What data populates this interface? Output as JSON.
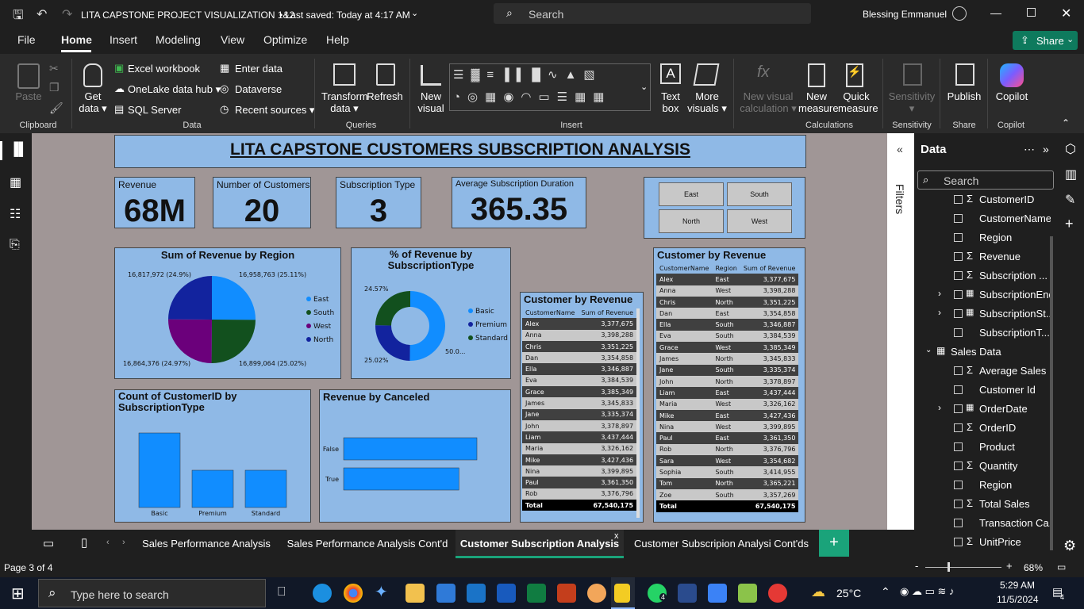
{
  "titlebar": {
    "title": "LITA CAPSTONE PROJECT VISUALIZATION 1&2",
    "saved": "• Last saved: Today at 4:17 AM",
    "search": "Search",
    "user": "Blessing Emmanuel"
  },
  "menu": [
    "File",
    "Home",
    "Insert",
    "Modeling",
    "View",
    "Optimize",
    "Help"
  ],
  "share_label": "Share",
  "ribbon": {
    "paste": "Paste",
    "get_data": "Get\ndata ▾",
    "excel": "Excel workbook",
    "onelake": "OneLake data hub ▾",
    "sql": "SQL Server",
    "enter_data": "Enter data",
    "dataverse": "Dataverse",
    "recent": "Recent sources ▾",
    "transform": "Transform\ndata ▾",
    "refresh": "Refresh",
    "new_visual": "New\nvisual",
    "text_box": "Text\nbox",
    "more_visuals": "More\nvisuals ▾",
    "new_visual_calc": "New visual\ncalculation ▾",
    "new_measure": "New\nmeasure",
    "quick_measure": "Quick\nmeasure",
    "sensitivity": "Sensitivity\n▾",
    "publish": "Publish",
    "copilot": "Copilot",
    "groups": {
      "clipboard": "Clipboard",
      "data": "Data",
      "queries": "Queries",
      "insert": "Insert",
      "calculations": "Calculations",
      "sensitivity": "Sensitivity",
      "share": "Share",
      "copilot": "Copilot"
    }
  },
  "report": {
    "title": "LITA CAPSTONE CUSTOMERS SUBSCRIPTION ANALYSIS",
    "cards": [
      {
        "label": "Revenue",
        "value": "68M"
      },
      {
        "label": "Number of Customers",
        "value": "20"
      },
      {
        "label": "Subscription Type",
        "value": "3"
      },
      {
        "label": "Average Subscription Duration",
        "value": "365.35"
      }
    ],
    "slicer": [
      "East",
      "South",
      "North",
      "West"
    ],
    "pie": {
      "title": "Sum of Revenue by Region",
      "labels": [
        "16,817,972 (24.9%)",
        "16,958,763 (25.11%)",
        "16,864,376 (24.97%)",
        "16,899,064 (25.02%)"
      ]
    },
    "donut": {
      "title": "% of Revenue by SubscriptionType",
      "labels": [
        "24.57%",
        "25.02%",
        "50.0..."
      ]
    },
    "bar_count": {
      "title": "Count of CustomerID by SubscriptionType"
    },
    "bar_canceled": {
      "title": "Revenue by Canceled"
    },
    "table1": {
      "title": "Customer by Revenue",
      "headers": [
        "CustomerName",
        "Sum of Revenue"
      ],
      "rows": [
        [
          "Alex",
          "3,377,675"
        ],
        [
          "Anna",
          "3,398,288"
        ],
        [
          "Chris",
          "3,351,225"
        ],
        [
          "Dan",
          "3,354,858"
        ],
        [
          "Ella",
          "3,346,887"
        ],
        [
          "Eva",
          "3,384,539"
        ],
        [
          "Grace",
          "3,385,349"
        ],
        [
          "James",
          "3,345,833"
        ],
        [
          "Jane",
          "3,335,374"
        ],
        [
          "John",
          "3,378,897"
        ],
        [
          "Liam",
          "3,437,444"
        ],
        [
          "Maria",
          "3,326,162"
        ],
        [
          "Mike",
          "3,427,436"
        ],
        [
          "Nina",
          "3,399,895"
        ],
        [
          "Paul",
          "3,361,350"
        ],
        [
          "Rob",
          "3,376,796"
        ]
      ],
      "total": [
        "Total",
        "67,540,175"
      ]
    },
    "table2": {
      "title": "Customer by Revenue",
      "headers": [
        "CustomerName",
        "Region",
        "Sum of Revenue"
      ],
      "rows": [
        [
          "Alex",
          "East",
          "3,377,675"
        ],
        [
          "Anna",
          "West",
          "3,398,288"
        ],
        [
          "Chris",
          "North",
          "3,351,225"
        ],
        [
          "Dan",
          "East",
          "3,354,858"
        ],
        [
          "Ella",
          "South",
          "3,346,887"
        ],
        [
          "Eva",
          "South",
          "3,384,539"
        ],
        [
          "Grace",
          "West",
          "3,385,349"
        ],
        [
          "James",
          "North",
          "3,345,833"
        ],
        [
          "Jane",
          "South",
          "3,335,374"
        ],
        [
          "John",
          "North",
          "3,378,897"
        ],
        [
          "Liam",
          "East",
          "3,437,444"
        ],
        [
          "Maria",
          "West",
          "3,326,162"
        ],
        [
          "Mike",
          "East",
          "3,427,436"
        ],
        [
          "Nina",
          "West",
          "3,399,895"
        ],
        [
          "Paul",
          "East",
          "3,361,350"
        ],
        [
          "Rob",
          "North",
          "3,376,796"
        ],
        [
          "Sara",
          "West",
          "3,354,682"
        ],
        [
          "Sophia",
          "South",
          "3,414,955"
        ],
        [
          "Tom",
          "North",
          "3,365,221"
        ],
        [
          "Zoe",
          "South",
          "3,357,269"
        ]
      ],
      "total": [
        "Total",
        "",
        "67,540,175"
      ]
    }
  },
  "chart_data": [
    {
      "type": "pie",
      "title": "Sum of Revenue by Region",
      "categories": [
        "East",
        "South",
        "West",
        "North"
      ],
      "values": [
        16958763,
        16899064,
        16864376,
        16817972
      ],
      "legend": "right",
      "colors": [
        "#118dff",
        "#12501e",
        "#6b007b",
        "#12239e"
      ]
    },
    {
      "type": "pie",
      "title": "% of Revenue by SubscriptionType",
      "categories": [
        "Basic",
        "Premium",
        "Standard"
      ],
      "values": [
        50.0,
        25.02,
        24.57
      ],
      "legend": "right",
      "colors": [
        "#118dff",
        "#12239e",
        "#12501e"
      ]
    },
    {
      "type": "bar",
      "title": "Count of CustomerID by SubscriptionType",
      "categories": [
        "Basic",
        "Premium",
        "Standard"
      ],
      "values": [
        10,
        5,
        5
      ]
    },
    {
      "type": "bar",
      "title": "Revenue by Canceled",
      "categories": [
        "False",
        "True"
      ],
      "values": [
        37,
        32
      ]
    }
  ],
  "filters_label": "Filters",
  "data_pane": {
    "title": "Data",
    "search": "Search",
    "fields": [
      {
        "name": "CustomerID",
        "sigma": true,
        "expand": false,
        "indent": 1
      },
      {
        "name": "CustomerName",
        "sigma": false,
        "expand": false,
        "indent": 1
      },
      {
        "name": "Region",
        "sigma": false,
        "expand": false,
        "indent": 1
      },
      {
        "name": "Revenue",
        "sigma": true,
        "expand": false,
        "indent": 1
      },
      {
        "name": "Subscription ...",
        "sigma": true,
        "expand": false,
        "indent": 1
      },
      {
        "name": "SubscriptionEnd",
        "sigma": false,
        "expand": true,
        "indent": 1
      },
      {
        "name": "SubscriptionSt...",
        "sigma": false,
        "expand": true,
        "indent": 1
      },
      {
        "name": "SubscriptionT...",
        "sigma": false,
        "expand": false,
        "indent": 1
      },
      {
        "name": "Sales Data",
        "table": true
      },
      {
        "name": "Average Sales",
        "sigma": true,
        "expand": false,
        "indent": 1
      },
      {
        "name": "Customer Id",
        "sigma": false,
        "expand": false,
        "indent": 1
      },
      {
        "name": "OrderDate",
        "sigma": false,
        "expand": true,
        "indent": 1
      },
      {
        "name": "OrderID",
        "sigma": true,
        "expand": false,
        "indent": 1
      },
      {
        "name": "Product",
        "sigma": false,
        "expand": false,
        "indent": 1
      },
      {
        "name": "Quantity",
        "sigma": true,
        "expand": false,
        "indent": 1
      },
      {
        "name": "Region",
        "sigma": false,
        "expand": false,
        "indent": 1
      },
      {
        "name": "Total Sales",
        "sigma": true,
        "expand": false,
        "indent": 1
      },
      {
        "name": "Transaction Ca...",
        "sigma": false,
        "expand": false,
        "indent": 1
      },
      {
        "name": "UnitPrice",
        "sigma": true,
        "expand": false,
        "indent": 1
      }
    ]
  },
  "tabs": [
    "Sales Performance Analysis",
    "Sales Performance Analysis Cont'd",
    "Customer Subscription Analysis",
    "Customer Subscripion Analysi Cont'ds"
  ],
  "status": {
    "page": "Page 3 of 4",
    "zoom": "68%"
  },
  "taskbar": {
    "search": "Type here to search",
    "temp": "25°C",
    "time": "5:29 AM",
    "date": "11/5/2024",
    "notif": "4",
    "wa_badge": "4"
  }
}
